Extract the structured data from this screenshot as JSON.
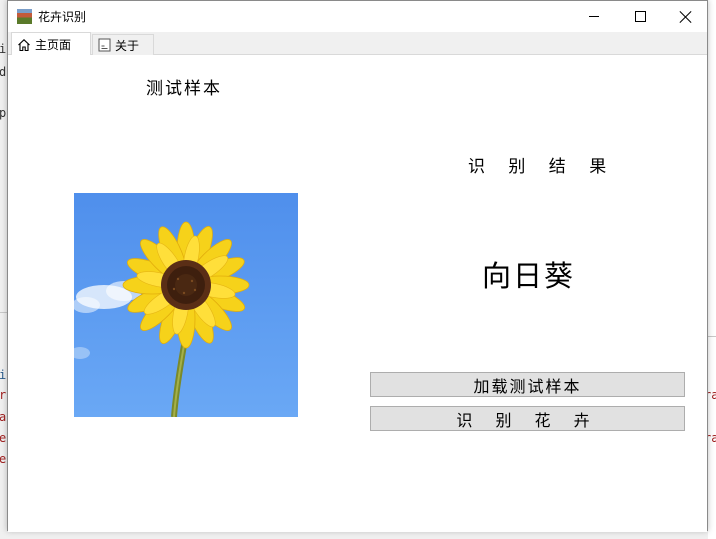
{
  "window": {
    "title": "花卉识别"
  },
  "tabs": [
    {
      "label": "主页面",
      "icon": "home-icon",
      "active": true
    },
    {
      "label": "关于",
      "icon": "document-icon",
      "active": false
    }
  ],
  "main": {
    "sample_label": "测试样本",
    "result_title": "识 别 结 果",
    "result_value": "向日葵",
    "sample_image": "sunflower",
    "load_button": "加载测试样本",
    "recognize_button": "识 别 花 卉"
  },
  "background": {
    "left_fragments": [
      "i",
      "d",
      "p",
      "i",
      "r",
      "a",
      "e",
      "e"
    ],
    "right_fragments": [
      "ra",
      "ra"
    ]
  },
  "colors": {
    "sky": "#5a97ee",
    "petal": "#f6d21a",
    "flower_center": "#5a2e16",
    "stem": "#7a8a2a",
    "button_bg": "#e1e1e1"
  }
}
